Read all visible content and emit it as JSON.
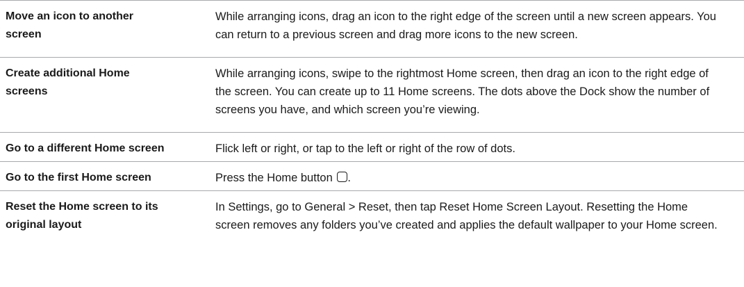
{
  "rows": [
    {
      "task": "Move an icon to another screen",
      "description": "While arranging icons, drag an icon to the right edge of the screen until a new screen appears. You can return to a previous screen and drag more icons to the new screen."
    },
    {
      "task": "Create additional Home screens",
      "description": "While arranging icons, swipe to the rightmost Home screen, then drag an icon to the right edge of the screen. You can create up to 11 Home screens. The dots above the Dock show the number of screens you have, and which screen you’re viewing."
    },
    {
      "task": "Go to a different Home screen",
      "description": "Flick left or right, or tap to the left or right of the row of dots."
    },
    {
      "task": "Go to the first Home screen",
      "description": "Press the Home button",
      "icon": "home-button-icon"
    },
    {
      "task": "Reset the Home screen to its original layout",
      "description": "In Settings, go to General > Reset, then tap Reset Home Screen Layout. Resetting the Home screen removes any folders you’ve created and applies the default wallpaper to your Home screen."
    }
  ]
}
